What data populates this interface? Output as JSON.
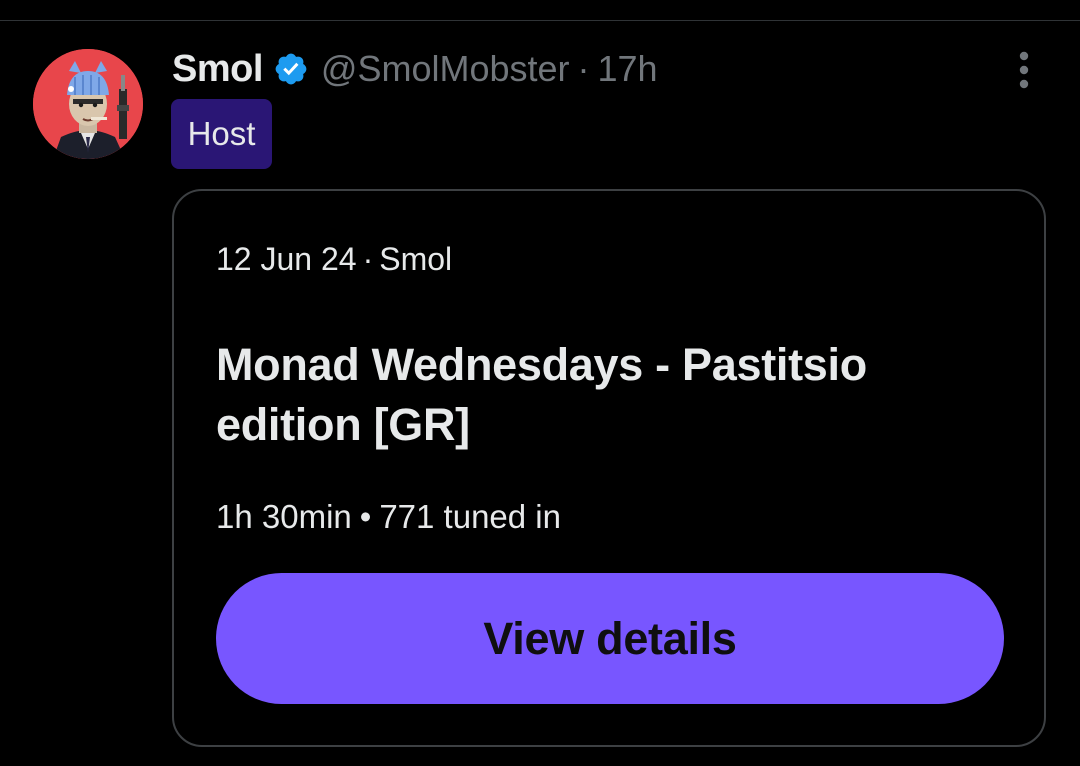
{
  "post": {
    "author": {
      "display_name": "Smol",
      "handle": "@SmolMobster",
      "verified": true,
      "avatar_icon": "avatar-cartoon-mobster",
      "avatar_bg": "#e8464b"
    },
    "separator": "·",
    "time": "17h",
    "badge": "Host",
    "badge_color": "#2a1675",
    "more_icon": "more-vertical-icon"
  },
  "space_card": {
    "date": "12 Jun 24",
    "separator": "·",
    "host": "Smol",
    "title": "Monad Wednesdays - Pastitsio edition [GR]",
    "duration": "1h 30min",
    "stats_separator": "•",
    "tuned_in": "771 tuned in",
    "button_label": "View details",
    "accent": "#7856ff"
  },
  "colors": {
    "background": "#000000",
    "text": "#e7e9ea",
    "muted": "#71767b",
    "verified": "#1d9bf0",
    "border": "#3d4043"
  }
}
